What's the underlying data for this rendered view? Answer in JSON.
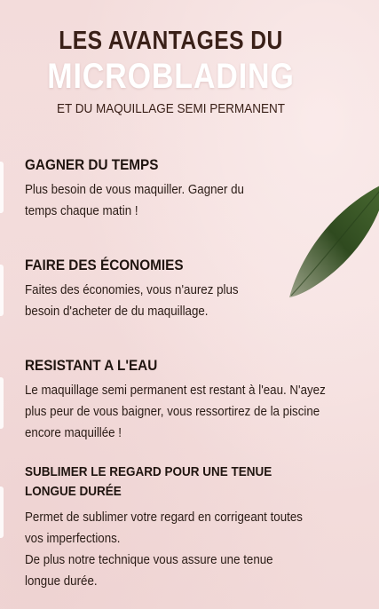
{
  "header": {
    "title_line1": "LES AVANTAGES DU",
    "title_line2": "MICROBLADING",
    "subtitle": "ET DU MAQUILLAGE SEMI PERMANENT"
  },
  "sections": [
    {
      "title": "GAGNER DU TEMPS",
      "lines": [
        "Plus besoin de vous maquiller.  Gagner du",
        "temps chaque matin !"
      ]
    },
    {
      "title": "FAIRE DES ÉCONOMIES",
      "lines": [
        "Faites des économies, vous n'aurez plus",
        "besoin d'acheter de du maquillage."
      ]
    },
    {
      "title": "RESISTANT A L'EAU",
      "lines": [
        "Le maquillage semi permanent est restant à l'eau. N'ayez",
        "plus peur de vous baigner, vous ressortirez de la piscine",
        "encore maquillée !"
      ]
    },
    {
      "title_lines": [
        "SUBLIMER LE REGARD POUR UNE TENUE",
        "LONGUE DURÉE"
      ],
      "lines": [
        "Permet de sublimer votre regard en corrigeant toutes",
        "vos imperfections.",
        "De plus notre technique vous assure une tenue",
        "longue durée."
      ]
    }
  ],
  "colors": {
    "background": "#f4dedd",
    "title_dark": "#3a2018",
    "title_light": "#ffffff",
    "leaf": "#3d5a2a"
  }
}
